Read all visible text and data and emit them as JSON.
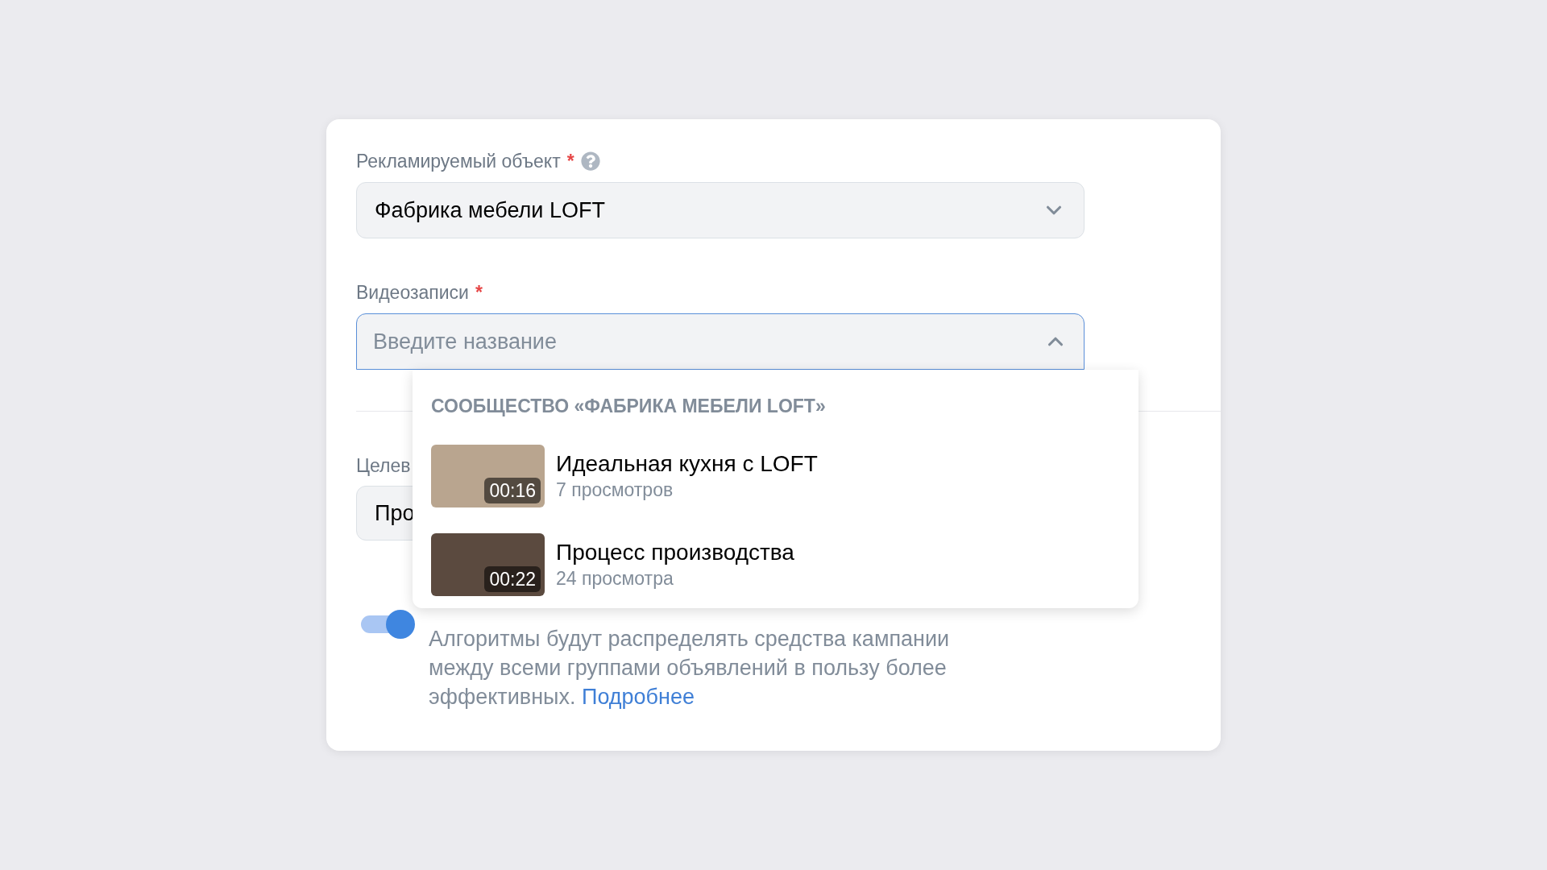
{
  "fields": [
    {
      "label": "Рекламируемый объект",
      "required_mark": "*",
      "help": true,
      "value": "Фабрика мебели LOFT",
      "expanded": false
    },
    {
      "label": "Видеозаписи",
      "required_mark": "*",
      "placeholder": "Введите название",
      "expanded": true
    }
  ],
  "dropdown": {
    "group_title": "СООБЩЕСТВО «ФАБРИКА МЕБЕЛИ LOFT»",
    "items": [
      {
        "title": "Идеальная кухня с LOFT",
        "duration": "00:16",
        "views": "7 просмотров"
      },
      {
        "title": "Процесс производства",
        "duration": "00:22",
        "views": "24 просмотра"
      }
    ]
  },
  "covered_field": {
    "label": "Целев",
    "value": "Про"
  },
  "toggle": {
    "on": true,
    "description": "Алгоритмы будут распределять средства кампании между всеми группами объявлений в пользу более эффективных.",
    "link": "Подробнее"
  }
}
